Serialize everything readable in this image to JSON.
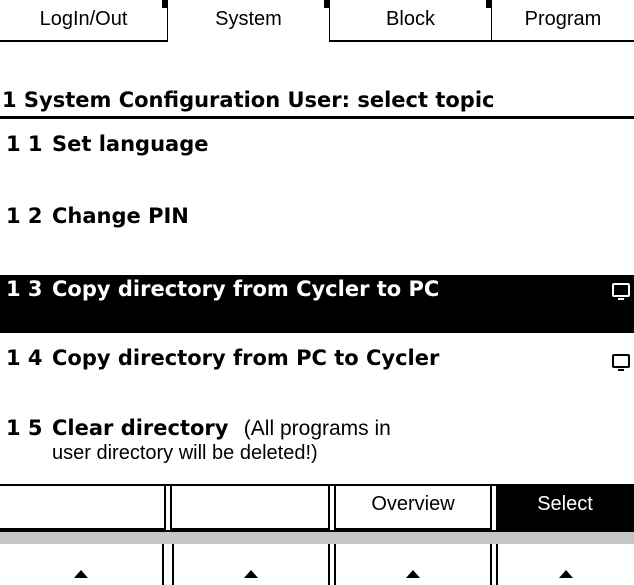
{
  "tabs": [
    {
      "label": "LogIn/Out"
    },
    {
      "label": "System"
    },
    {
      "label": "Block"
    },
    {
      "label": "Program"
    }
  ],
  "header": {
    "title": "1 System Configuration User: select topic"
  },
  "menu": [
    {
      "num": "1 1",
      "label": "Set language",
      "has_pc_icon": false
    },
    {
      "num": "1 2",
      "label": "Change PIN",
      "has_pc_icon": false
    },
    {
      "num": "1 3",
      "label": "Copy directory from Cycler to PC",
      "has_pc_icon": true,
      "selected": true
    },
    {
      "num": "1 4",
      "label": "Copy directory from PC to Cycler",
      "has_pc_icon": true
    },
    {
      "num": "1 5",
      "label": "Clear directory",
      "note_line1": "(All programs in",
      "note_line2": "user directory will be deleted!)"
    }
  ],
  "softkeys": [
    {
      "label": ""
    },
    {
      "label": ""
    },
    {
      "label": "Overview"
    },
    {
      "label": "Select"
    }
  ],
  "hardware_buttons": [
    {
      "icon": "up-arrow-icon"
    },
    {
      "icon": "up-arrow-icon"
    },
    {
      "icon": "up-arrow-icon"
    },
    {
      "icon": "up-arrow-icon"
    }
  ]
}
